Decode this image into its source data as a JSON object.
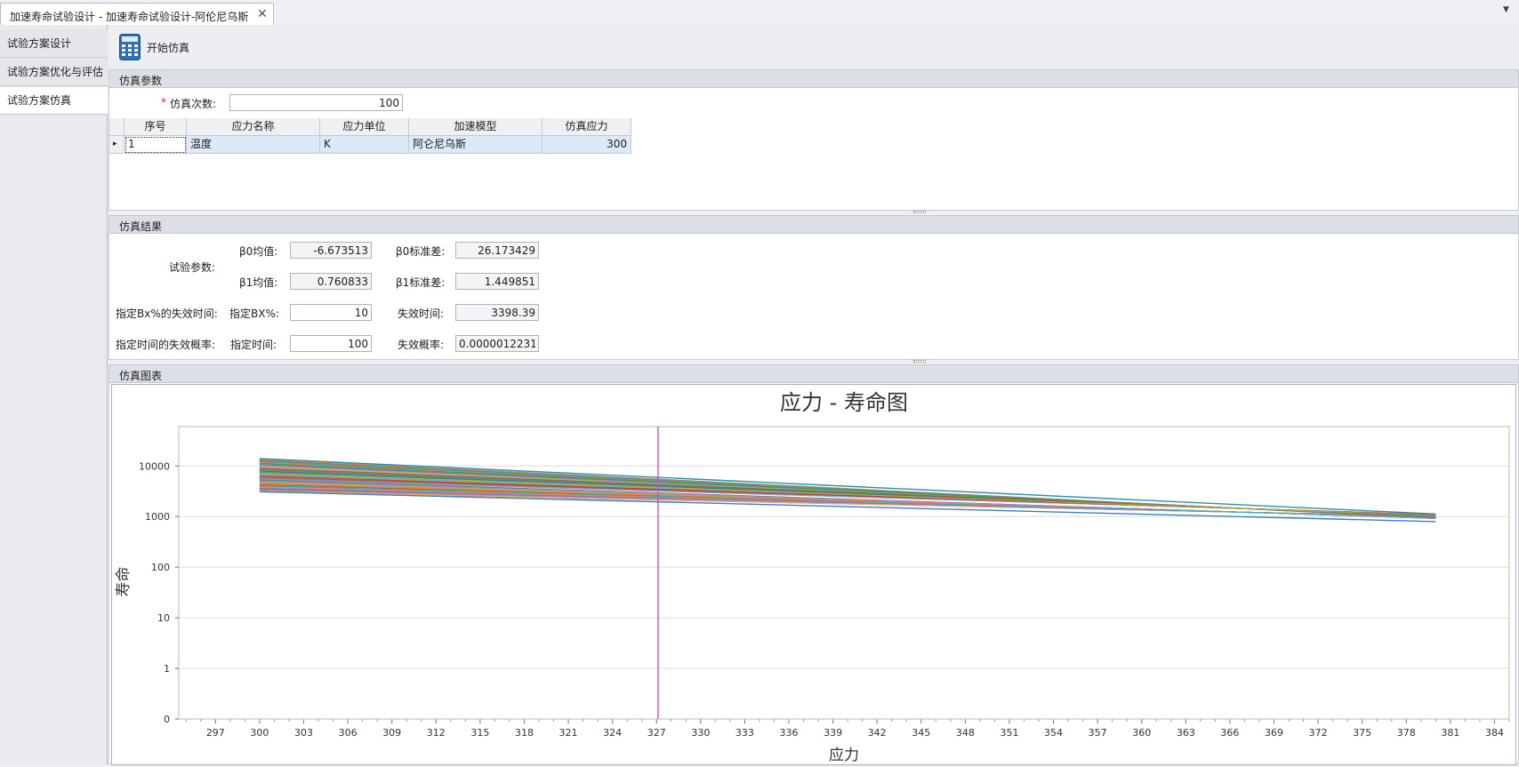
{
  "doc_tab": {
    "title": "加速寿命试验设计 - 加速寿命试验设计-阿伦尼乌斯",
    "close_glyph": "✕"
  },
  "tab_menu_glyph": "▼",
  "nav": {
    "items": [
      {
        "label": "试验方案设计"
      },
      {
        "label": "试验方案优化与评估"
      },
      {
        "label": "试验方案仿真"
      }
    ],
    "active_index": 2
  },
  "toolbar": {
    "start_label": "开始仿真",
    "start_icon": "calculator-icon"
  },
  "params": {
    "title": "仿真参数",
    "required_mark": "*",
    "count_label": "仿真次数:",
    "count_value": "100",
    "grid": {
      "headers": [
        "序号",
        "应力名称",
        "应力单位",
        "加速模型",
        "仿真应力"
      ],
      "row": {
        "indicator": "▸",
        "cells": [
          "1",
          "温度",
          "K",
          "阿仑尼乌斯",
          "300"
        ]
      }
    }
  },
  "results": {
    "title": "仿真结果",
    "test_params_label": "试验参数:",
    "b0_mean_label": "β0均值:",
    "b0_mean": "-6.673513",
    "b0_std_label": "β0标准差:",
    "b0_std": "26.173429",
    "b1_mean_label": "β1均值:",
    "b1_mean": "0.760833",
    "b1_std_label": "β1标准差:",
    "b1_std": "1.449851",
    "bx_row_label": "指定Bx%的失效时间:",
    "bx_label": "指定BX%:",
    "bx_value": "10",
    "fail_time_label": "失效时间:",
    "fail_time": "3398.39",
    "time_row_label": "指定时间的失效概率:",
    "time_label": "指定时间:",
    "time_value": "100",
    "fail_prob_label": "失效概率:",
    "fail_prob": "0.0000012231E"
  },
  "chart_panel": {
    "title": "仿真图表"
  },
  "chart_data": {
    "type": "line",
    "title": "应力 - 寿命图",
    "xlabel": "应力",
    "ylabel": "寿命",
    "xlim": [
      294.5,
      385
    ],
    "x_ticks": [
      297,
      300,
      303,
      306,
      309,
      312,
      315,
      318,
      321,
      324,
      327,
      330,
      333,
      336,
      339,
      342,
      345,
      348,
      351,
      354,
      357,
      360,
      363,
      366,
      369,
      372,
      375,
      378,
      381,
      384
    ],
    "y_scale": "log",
    "y_tick_values": [
      0.1,
      1,
      10,
      100,
      1000,
      10000
    ],
    "y_tick_labels": [
      "0",
      "1",
      "10",
      "100",
      "1000",
      "10000"
    ],
    "ylim": [
      0.1,
      60000
    ],
    "grid": true,
    "legend": "none",
    "series_count": 100,
    "x_range": [
      300,
      380
    ],
    "series_life_at_300": [
      3100,
      14000
    ],
    "series_life_at_380": [
      780,
      1150
    ],
    "stress_marker_x": 327.1,
    "marker_color": "#d63fd6",
    "palette": [
      "#1f77b4",
      "#ff7f0e",
      "#2ca02c",
      "#d62728",
      "#9467bd",
      "#8c564b",
      "#e377c2",
      "#7f7f7f",
      "#bcbd22",
      "#17becf",
      "#6baed6",
      "#fd8d3c",
      "#74c476",
      "#9e9ac8",
      "#fdae6b"
    ]
  }
}
